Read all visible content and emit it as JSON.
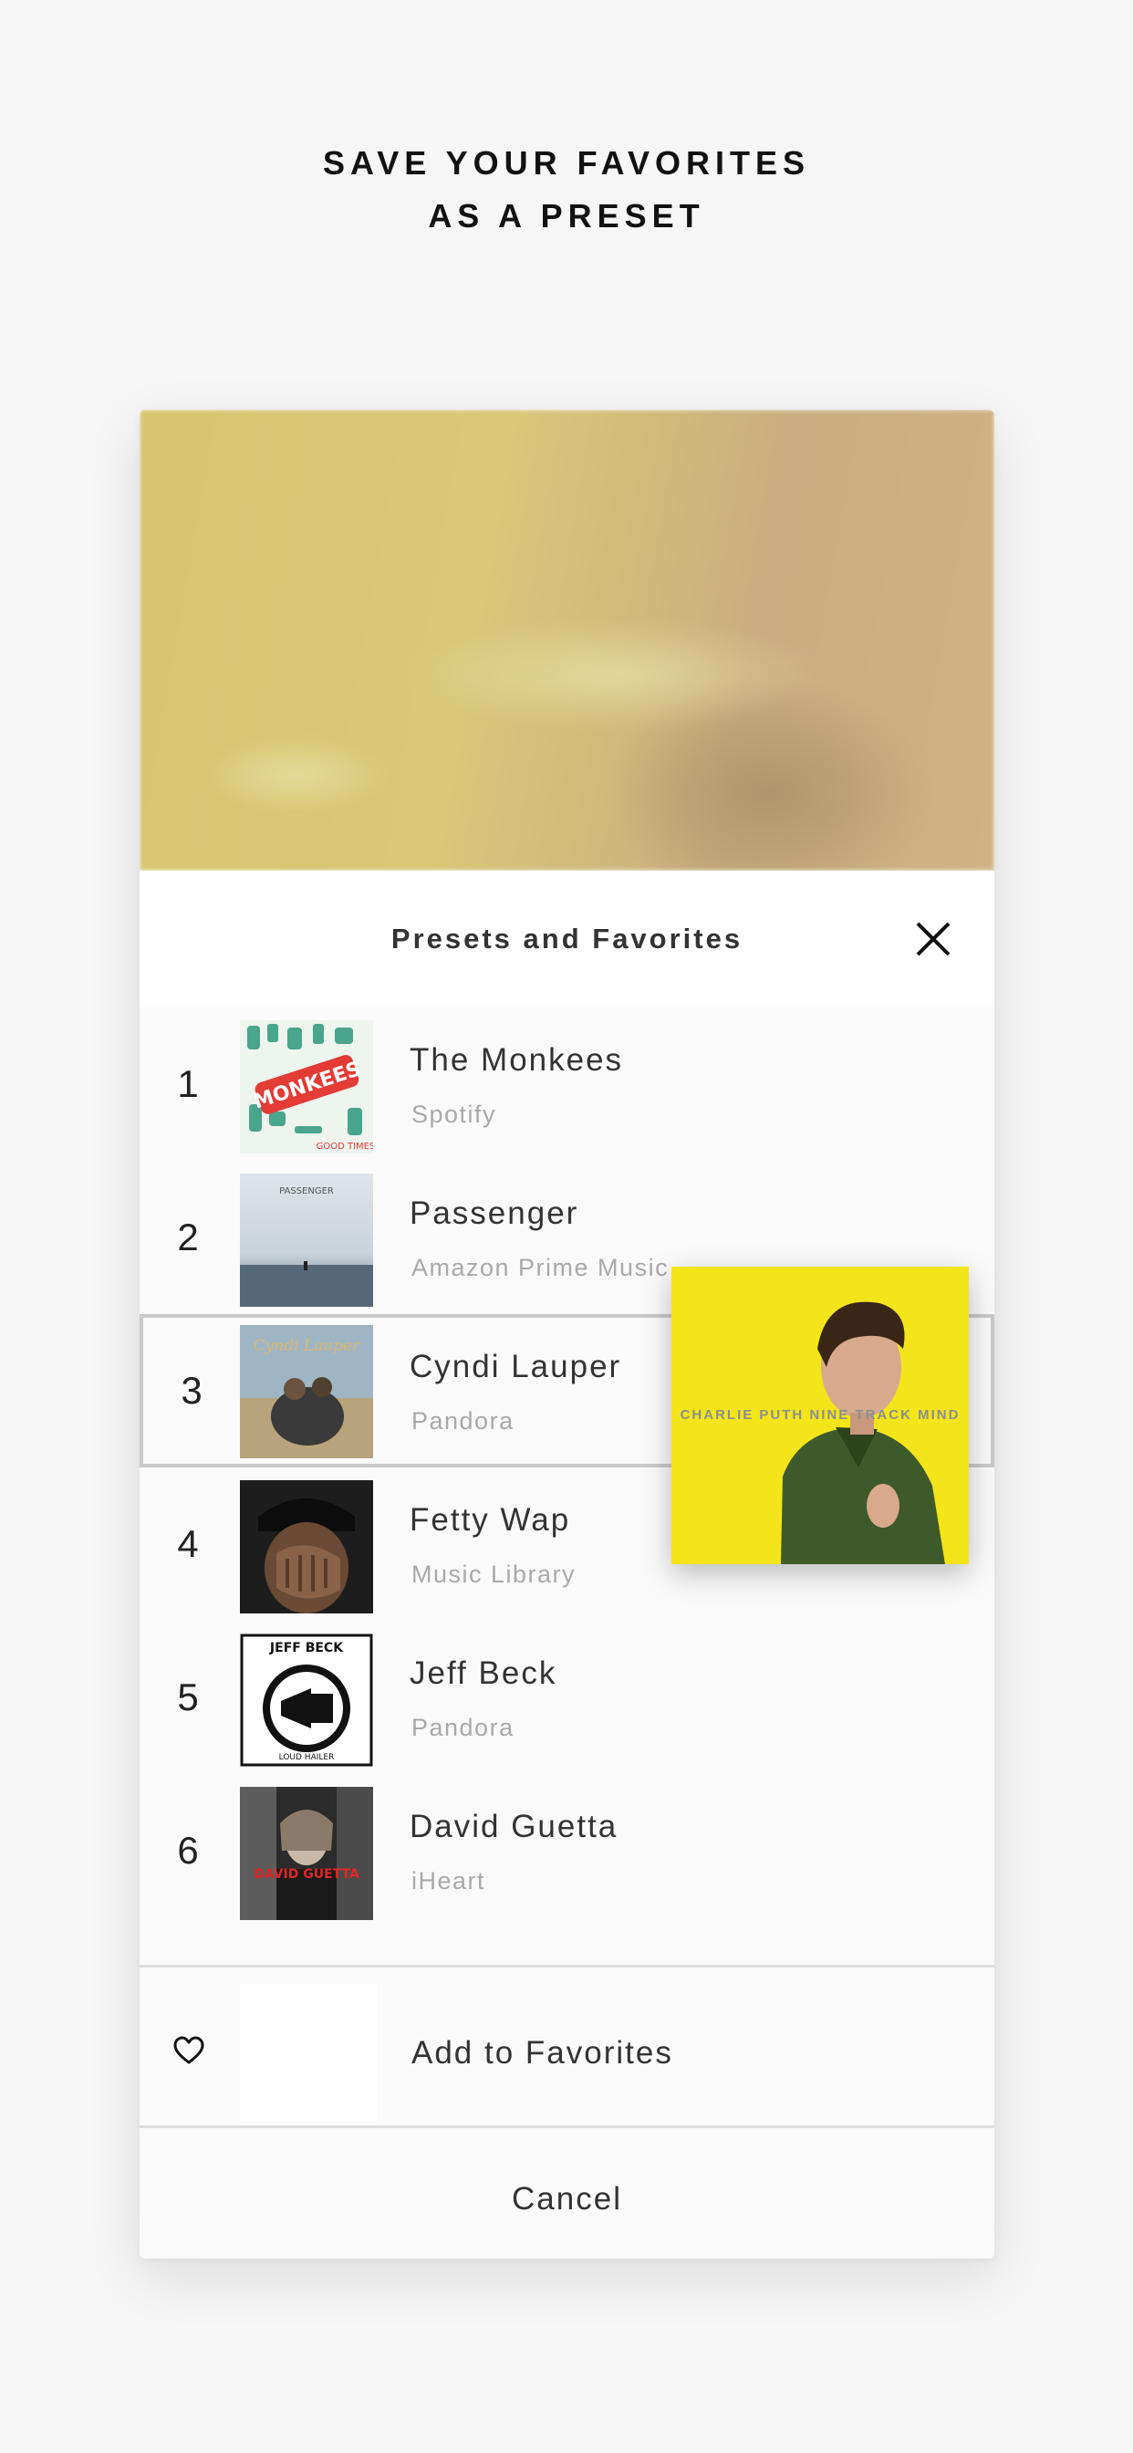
{
  "headline": [
    "SAVE YOUR FAVORITES",
    "AS A PRESET"
  ],
  "sheet": {
    "title": "Presets and Favorites",
    "close_icon": "close-icon"
  },
  "presets": [
    {
      "number": "1",
      "title": "The Monkees",
      "source": "Spotify"
    },
    {
      "number": "2",
      "title": "Passenger",
      "source": "Amazon Prime Music"
    },
    {
      "number": "3",
      "title": "Cyndi Lauper",
      "source": "Pandora"
    },
    {
      "number": "4",
      "title": "Fetty Wap",
      "source": "Music Library"
    },
    {
      "number": "5",
      "title": "Jeff Beck",
      "source": "Pandora"
    },
    {
      "number": "6",
      "title": "David Guetta",
      "source": "iHeart"
    }
  ],
  "art_text": {
    "monkees_logo": "MONKEES",
    "monkees_sub": "GOOD TIMES!",
    "passenger": "PASSENGER",
    "cyndi": "Cyndi Lauper",
    "jeffbeck": "JEFF BECK",
    "jeffbeck_sub": "LOUD HAILER",
    "guetta": "DAVID GUETTA"
  },
  "favorites": {
    "heart_icon": "heart-icon",
    "label": "Add to Favorites"
  },
  "cancel_label": "Cancel",
  "dragging_album": {
    "text": "CHARLIE PUTH NINE TRACK MIND"
  },
  "colors": {
    "page_bg": "#f6f6f6",
    "drag_album_bg": "#f4e41a",
    "selected_border": "#c9c9c9",
    "secondary_text": "#a9a9a9"
  }
}
